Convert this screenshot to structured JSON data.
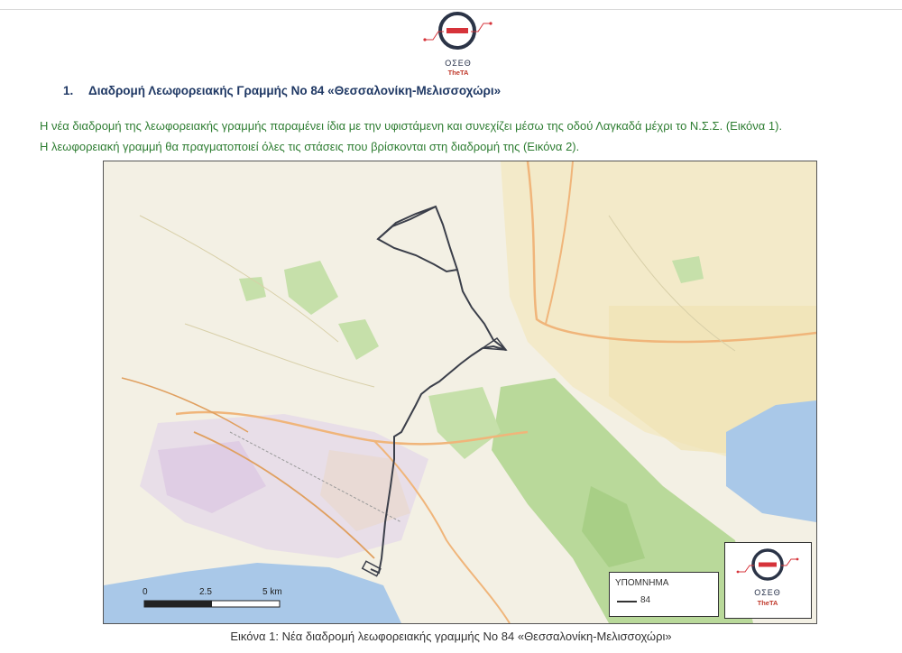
{
  "header": {
    "logo_name": "ΟΣΕΘ",
    "logo_sub": "TheTA"
  },
  "heading": {
    "number": "1.",
    "title": "Διαδρομή Λεωφορειακής Γραμμής Νο 84 «Θεσσαλονίκη-Μελισσοχώρι»"
  },
  "body": {
    "line1": "Η νέα διαδρομή της λεωφορειακής γραμμής παραμένει ίδια με την υφιστάμενη και συνεχίζει μέσω της οδού Λαγκαδά μέχρι το Ν.Σ.Σ. (Εικόνα 1).",
    "line2": "Η λεωφορειακή γραμμή θα πραγματοποιεί όλες τις στάσεις που βρίσκονται στη διαδρομή της (Εικόνα 2)."
  },
  "map": {
    "legend_title": "ΥΠΟΜΝΗΜΑ",
    "legend_item": "84",
    "scale_labels": [
      "0",
      "2.5",
      "5 km"
    ],
    "logo_name": "ΟΣΕΘ",
    "logo_sub": "TheTA",
    "route_color": "#3b3f4a",
    "water_color": "#a9c8e8",
    "green_color": "#b9d99a"
  },
  "caption": "Εικόνα 1: Νέα διαδρομή λεωφορειακής γραμμής Νο 84 «Θεσσαλονίκη-Μελισσοχώρι»"
}
